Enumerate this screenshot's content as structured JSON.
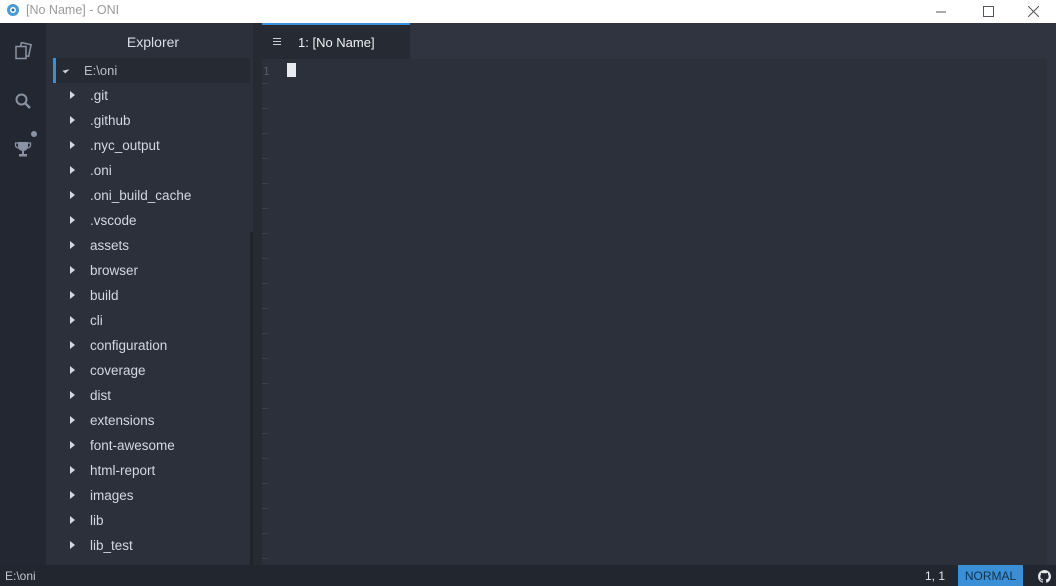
{
  "window": {
    "title": "[No Name] - ONI",
    "icons": [
      "oni-logo-icon",
      "minimize-icon",
      "maximize-icon",
      "close-icon"
    ]
  },
  "activity_bar": {
    "items": [
      {
        "name": "files-icon"
      },
      {
        "name": "search-icon"
      },
      {
        "name": "trophy-icon"
      }
    ]
  },
  "explorer": {
    "title": "Explorer",
    "root": "E:\\oni",
    "items": [
      {
        "label": ".git"
      },
      {
        "label": ".github"
      },
      {
        "label": ".nyc_output"
      },
      {
        "label": ".oni"
      },
      {
        "label": ".oni_build_cache"
      },
      {
        "label": ".vscode"
      },
      {
        "label": "assets"
      },
      {
        "label": "browser"
      },
      {
        "label": "build"
      },
      {
        "label": "cli"
      },
      {
        "label": "configuration"
      },
      {
        "label": "coverage"
      },
      {
        "label": "dist"
      },
      {
        "label": "extensions"
      },
      {
        "label": "font-awesome"
      },
      {
        "label": "html-report"
      },
      {
        "label": "images"
      },
      {
        "label": "lib"
      },
      {
        "label": "lib_test"
      }
    ]
  },
  "editor": {
    "tab_label": "1: [No Name]",
    "line_number": "1"
  },
  "status": {
    "path": "E:\\oni",
    "position": "1, 1",
    "mode": "NORMAL"
  },
  "colors": {
    "accent": "#3a8fd6",
    "background": "#2b303b",
    "sidebar": "#232731"
  }
}
